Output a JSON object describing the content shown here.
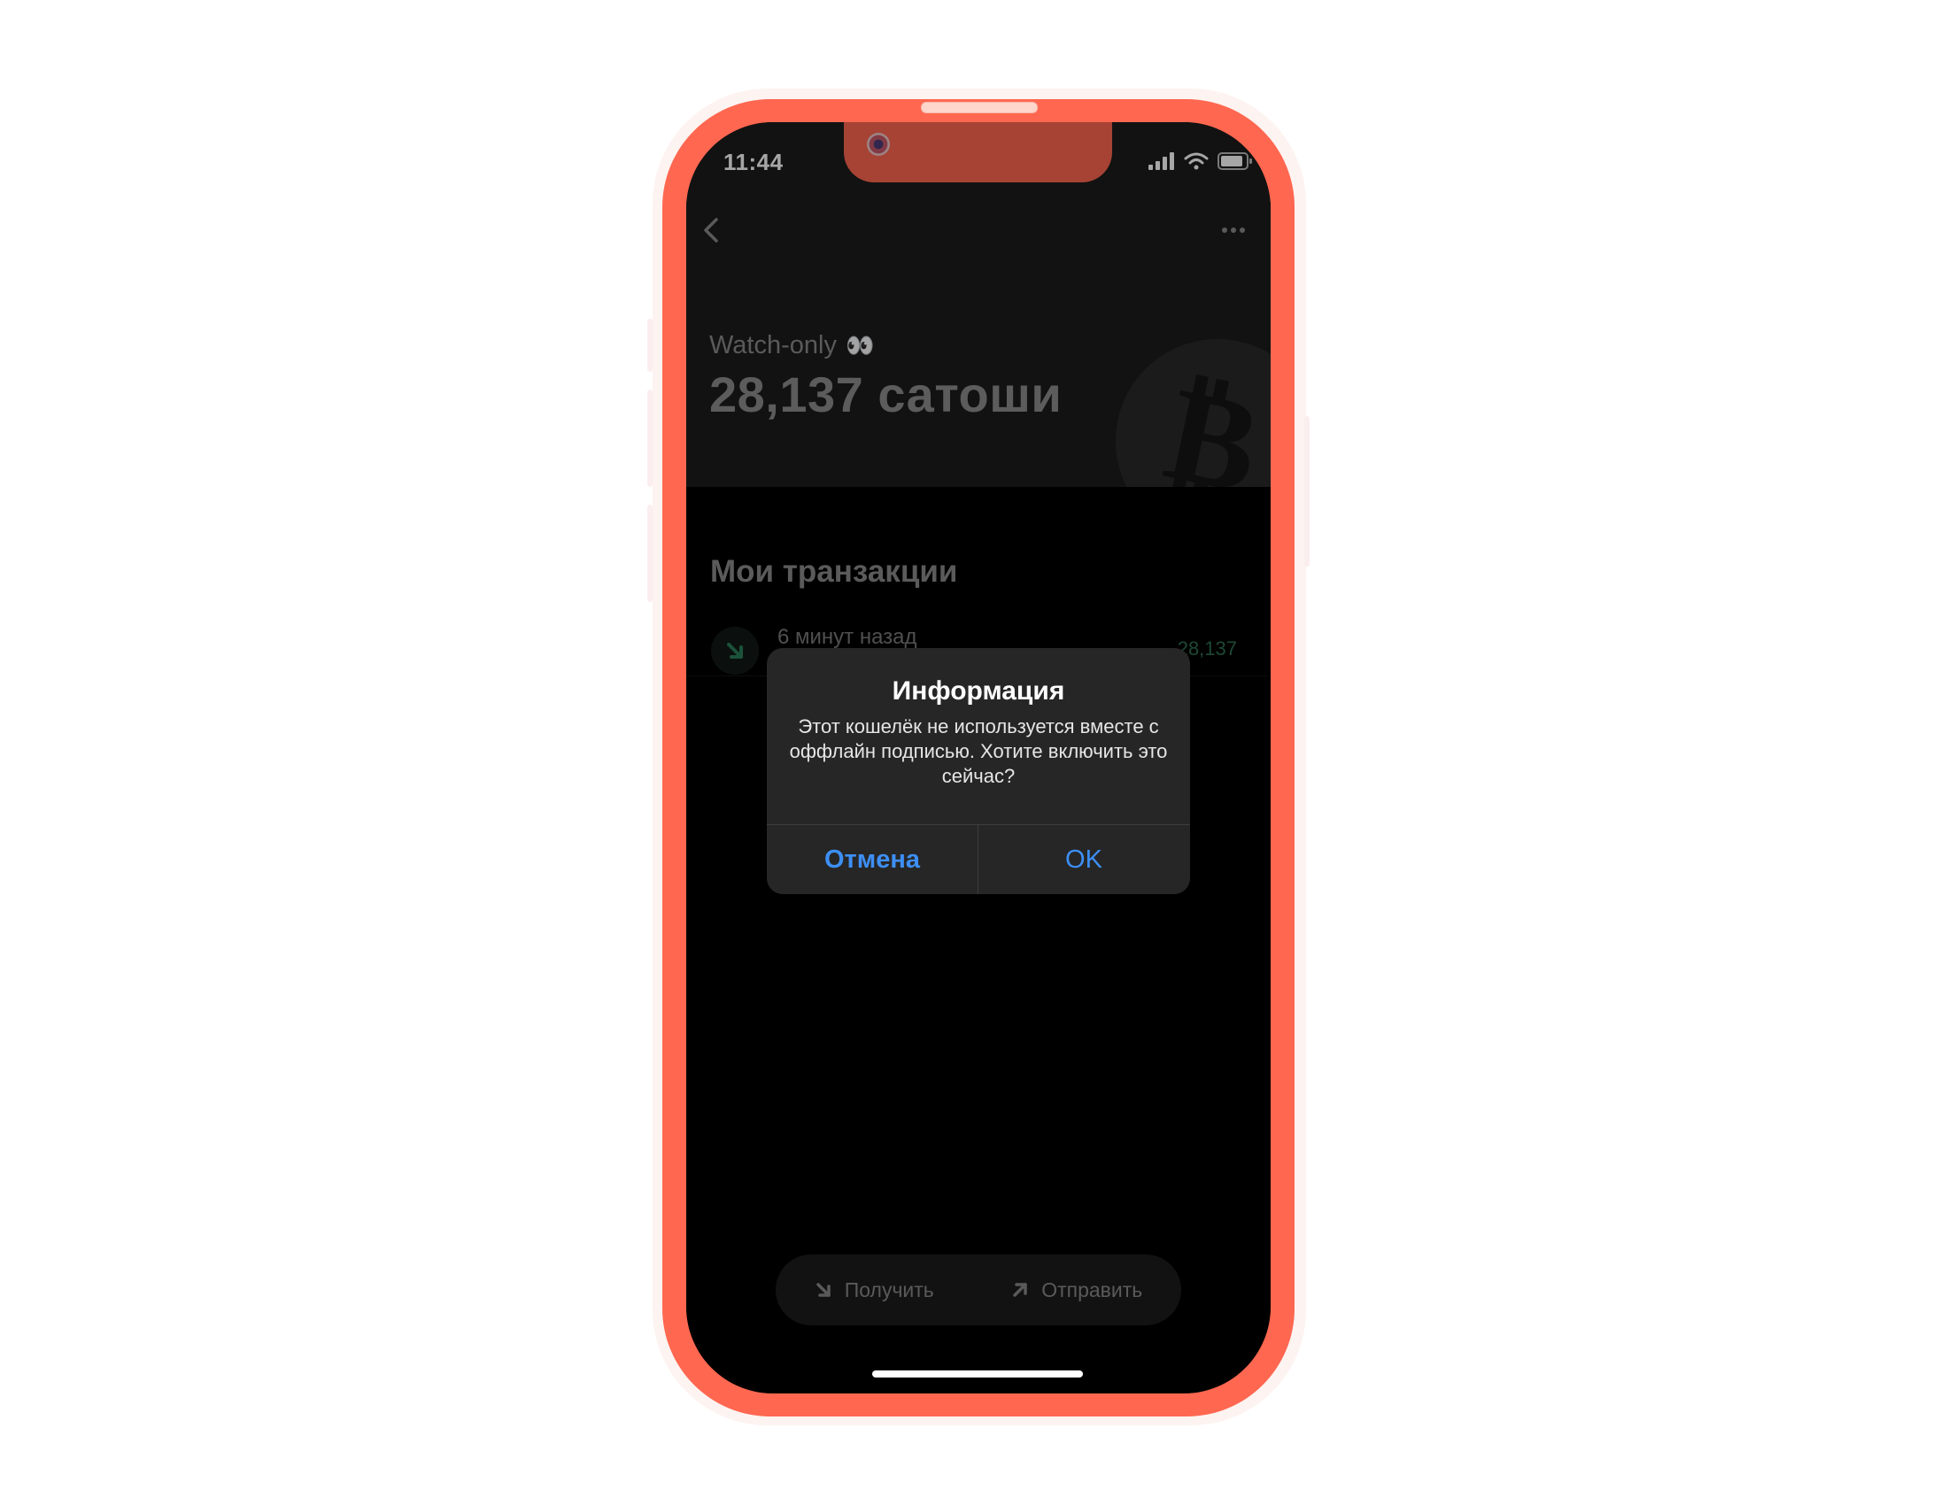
{
  "status_bar": {
    "time": "11:44"
  },
  "header": {
    "wallet_label": "Watch-only",
    "wallet_label_emoji": "👀",
    "balance": "28,137 сатоши",
    "back_icon": "chevron-left-icon",
    "more_icon": "ellipsis-icon",
    "bg_icon": "bitcoin-icon"
  },
  "transactions": {
    "title": "Мои транзакции",
    "items": [
      {
        "time": "6 минут назад",
        "amount": "28,137",
        "direction": "incoming",
        "icon": "arrow-down-right-icon"
      }
    ]
  },
  "alert": {
    "title": "Информация",
    "message": "Этот кошелёк не используется вместе с оффлайн подписью. Хотите включить это сейчас?",
    "cancel_label": "Отмена",
    "ok_label": "OK"
  },
  "actions": {
    "receive_label": "Получить",
    "send_label": "Отправить"
  },
  "colors": {
    "frame": "#ff6750",
    "accent_blue": "#3d8ff5",
    "incoming_green": "#2f6f52"
  }
}
